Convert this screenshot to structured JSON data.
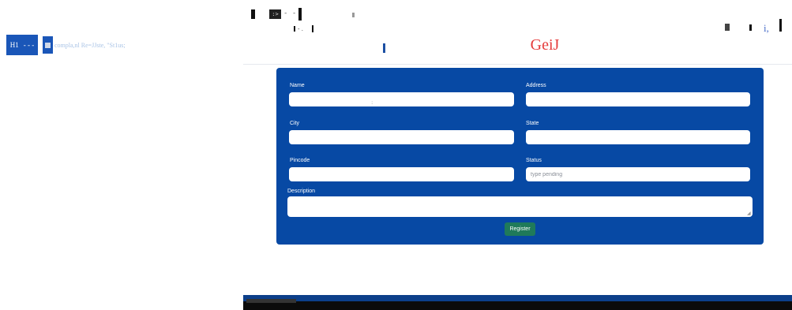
{
  "left_panel": {
    "h1_label": "H1",
    "h1_suffix": "- - -",
    "caption": "compla,nl Re=JJste,   \"St1us;"
  },
  "toolbar": {
    "icon_box_label": ":>",
    "dashes": "- -",
    "mini_mark": "- .",
    "right_letter": "i,"
  },
  "page": {
    "title": "GeiJ"
  },
  "form": {
    "name": {
      "label": "Name",
      "value": "",
      "placeholder": ""
    },
    "address": {
      "label": "Address",
      "value": "",
      "placeholder": ""
    },
    "city": {
      "label": "City",
      "value": "",
      "placeholder": ""
    },
    "state": {
      "label": "State",
      "value": "",
      "placeholder": ""
    },
    "pincode": {
      "label": "Pincode",
      "value": "",
      "placeholder": ""
    },
    "status": {
      "label": "Status",
      "value": "",
      "placeholder": "type pending"
    },
    "description": {
      "label": "Description",
      "value": "",
      "placeholder": ""
    },
    "submit_label": "Register"
  },
  "colors": {
    "form_bg": "#0749a4",
    "title": "#e53c3c",
    "submit_bg": "#1f7a5a"
  }
}
